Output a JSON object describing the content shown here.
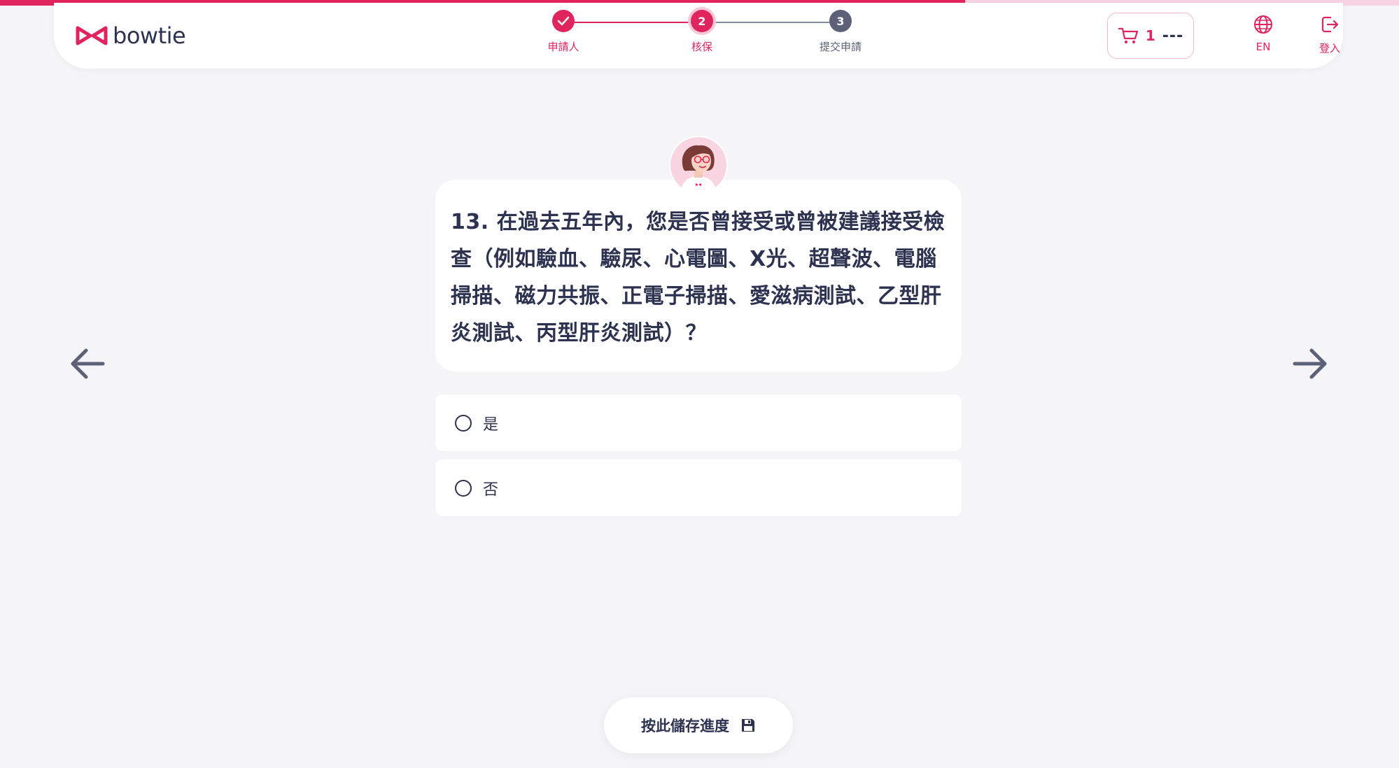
{
  "progress": {
    "fraction": 0.69
  },
  "brand": {
    "name": "bowtie",
    "logo_icon": "bowtie-logo-icon",
    "color": "#e0245e"
  },
  "stepper": {
    "steps": [
      {
        "label": "申請人",
        "state": "done",
        "icon": "check-icon"
      },
      {
        "label": "核保",
        "state": "active",
        "number": "2"
      },
      {
        "label": "提交申請",
        "state": "pending",
        "number": "3"
      }
    ]
  },
  "cart": {
    "icon": "cart-icon",
    "count": "1",
    "price": "---"
  },
  "language": {
    "icon": "globe-icon",
    "label": "EN"
  },
  "login": {
    "icon": "login-icon",
    "label": "登入"
  },
  "question": {
    "avatar_icon": "advisor-avatar-icon",
    "text": "13. 在過去五年內，您是否曾接受或曾被建議接受檢查（例如驗血、驗尿、心電圖、X光、超聲波、電腦掃描、磁力共振、正電子掃描、愛滋病測試、乙型肝炎測試、丙型肝炎測試）？",
    "options": [
      {
        "label": "是",
        "selected": false
      },
      {
        "label": "否",
        "selected": false
      }
    ]
  },
  "navigation": {
    "back_icon": "arrow-left-icon",
    "next_icon": "arrow-right-icon"
  },
  "save": {
    "label": "按此儲存進度",
    "icon": "floppy-disk-icon"
  },
  "colors": {
    "accent": "#e0245e",
    "text": "#2d3250",
    "background": "#f5f5f7"
  }
}
